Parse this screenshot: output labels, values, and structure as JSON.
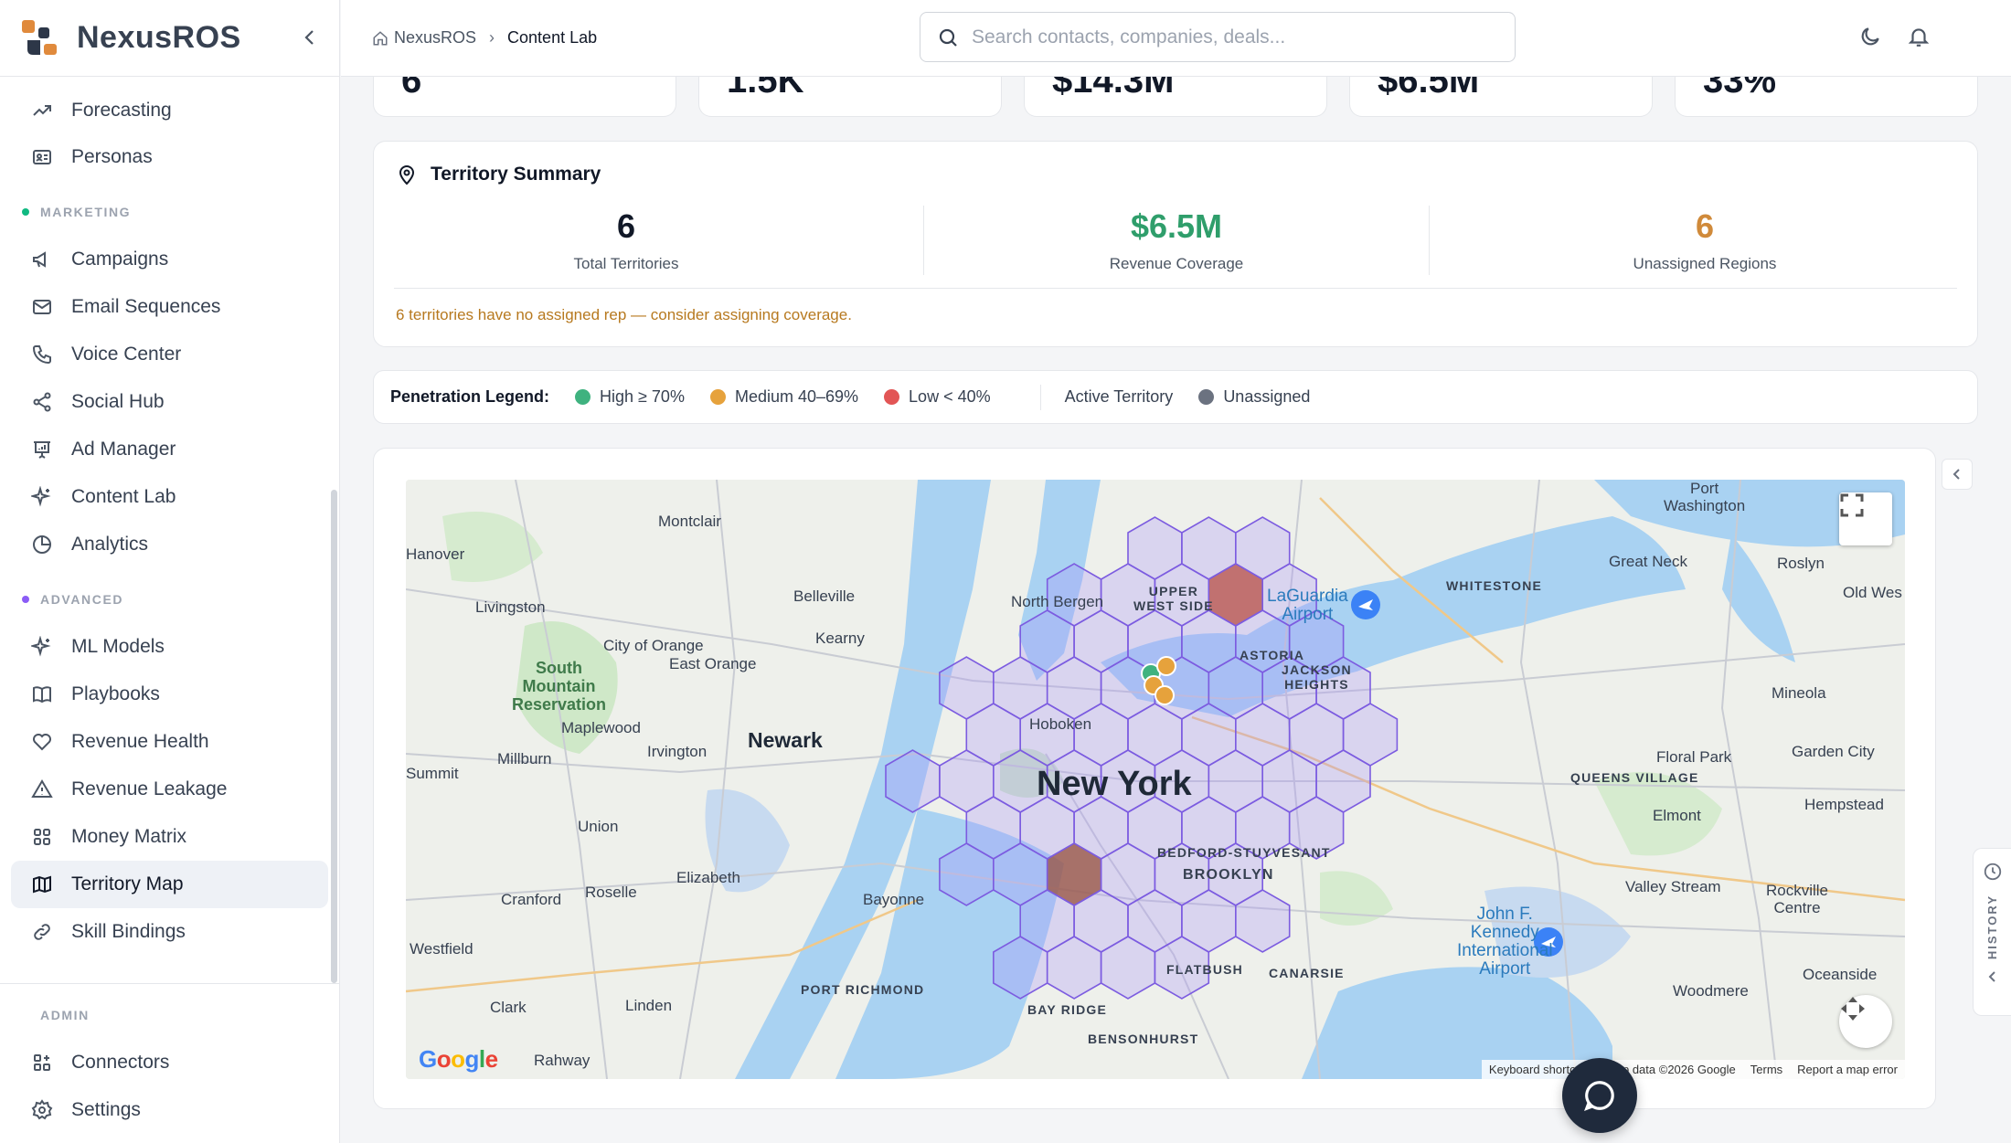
{
  "brand": {
    "name": "NexusROS"
  },
  "breadcrumb": {
    "home": "NexusROS",
    "current": "Content Lab"
  },
  "search": {
    "placeholder": "Search contacts, companies, deals..."
  },
  "sidebar": {
    "top_items": [
      {
        "label": "Forecasting",
        "icon": "trending-up-icon"
      },
      {
        "label": "Personas",
        "icon": "id-card-icon"
      }
    ],
    "marketing": {
      "title": "MARKETING",
      "color": "#10b981",
      "items": [
        {
          "label": "Campaigns",
          "icon": "megaphone-icon"
        },
        {
          "label": "Email Sequences",
          "icon": "mail-icon"
        },
        {
          "label": "Voice Center",
          "icon": "phone-icon"
        },
        {
          "label": "Social Hub",
          "icon": "share-icon"
        },
        {
          "label": "Ad Manager",
          "icon": "presentation-icon"
        },
        {
          "label": "Content Lab",
          "icon": "sparkles-icon"
        },
        {
          "label": "Analytics",
          "icon": "pie-chart-icon"
        }
      ]
    },
    "advanced": {
      "title": "ADVANCED",
      "color": "#8b5cf6",
      "items": [
        {
          "label": "ML Models",
          "icon": "sparkles-icon"
        },
        {
          "label": "Playbooks",
          "icon": "book-icon"
        },
        {
          "label": "Revenue Health",
          "icon": "heart-icon"
        },
        {
          "label": "Revenue Leakage",
          "icon": "alert-triangle-icon"
        },
        {
          "label": "Money Matrix",
          "icon": "grid-icon"
        },
        {
          "label": "Territory Map",
          "icon": "map-icon",
          "active": true
        },
        {
          "label": "Skill Bindings",
          "icon": "link-icon"
        }
      ]
    },
    "admin": {
      "title": "ADMIN",
      "items": [
        {
          "label": "Connectors",
          "icon": "connectors-icon"
        },
        {
          "label": "Settings",
          "icon": "settings-icon"
        }
      ]
    }
  },
  "kpi_partial": [
    "6",
    "1.5K",
    "$14.3M",
    "$6.5M",
    "33%"
  ],
  "summary": {
    "title": "Territory Summary",
    "stats": [
      {
        "value": "6",
        "label": "Total Territories",
        "color": "#111827"
      },
      {
        "value": "$6.5M",
        "label": "Revenue Coverage",
        "color": "#2f9e6b"
      },
      {
        "value": "6",
        "label": "Unassigned Regions",
        "color": "#d08a3a"
      }
    ],
    "warning": "6 territories have no assigned rep — consider assigning coverage."
  },
  "legend": {
    "title": "Penetration Legend:",
    "items": [
      {
        "label": "High ≥ 70%",
        "color": "#3fb27f"
      },
      {
        "label": "Medium 40–69%",
        "color": "#e6a23c"
      },
      {
        "label": "Low < 40%",
        "color": "#e25555"
      }
    ],
    "active": "Active Territory",
    "unassigned": {
      "label": "Unassigned",
      "color": "#6b7280"
    }
  },
  "map": {
    "labels": {
      "big": "New York",
      "newark": "Newark",
      "montclair": "Montclair",
      "hanover": "Hanover",
      "livingston": "Livingston",
      "belleville": "Belleville",
      "kearny": "Kearny",
      "city_of_orange": "City of Orange",
      "east_orange": "East Orange",
      "south_mountain": "South\nMountain\nReservation",
      "maplewood": "Maplewood",
      "irvington": "Irvington",
      "millburn": "Millburn",
      "summit": "Summit",
      "union": "Union",
      "elizabeth": "Elizabeth",
      "roselle": "Roselle",
      "cranford": "Cranford",
      "westfield": "Westfield",
      "clark": "Clark",
      "linden": "Linden",
      "rahway": "Rahway",
      "bayonne": "Bayonne",
      "port_richmond": "PORT RICHMOND",
      "bay_ridge": "BAY RIDGE",
      "bensonhurst": "BENSONHURST",
      "flatbush": "FLATBUSH",
      "canarsie": "CANARSIE",
      "brooklyn": "BROOKLYN",
      "bed_stuy": "BEDFORD-STUYVESANT",
      "hoboken": "Hoboken",
      "north_bergen": "North Bergen",
      "upper_west_side": "UPPER\nWEST SIDE",
      "astoria": "ASTORIA",
      "jackson_heights": "JACKSON\nHEIGHTS",
      "laguardia": "LaGuardia\nAirport",
      "whitestone": "WHITESTONE",
      "great_neck": "Great Neck",
      "port_washington": "Port\nWashington",
      "roslyn": "Roslyn",
      "old_westbury": "Old Wes",
      "mineola": "Mineola",
      "garden_city": "Garden City",
      "floral_park": "Floral Park",
      "queens_village": "QUEENS VILLAGE",
      "elmont": "Elmont",
      "hempstead": "Hempstead",
      "valley_stream": "Valley Stream",
      "rockville_centre": "Rockville\nCentre",
      "oceanside": "Oceanside",
      "woodmere": "Woodmere",
      "jfk": "John F.\nKennedy\nInternational\nAirport"
    },
    "logo": "Google",
    "attribution": [
      "Keyboard shortcuts",
      "Map data ©2026 Google",
      "Terms",
      "Report a map error"
    ]
  },
  "history": {
    "label": "HISTORY"
  }
}
